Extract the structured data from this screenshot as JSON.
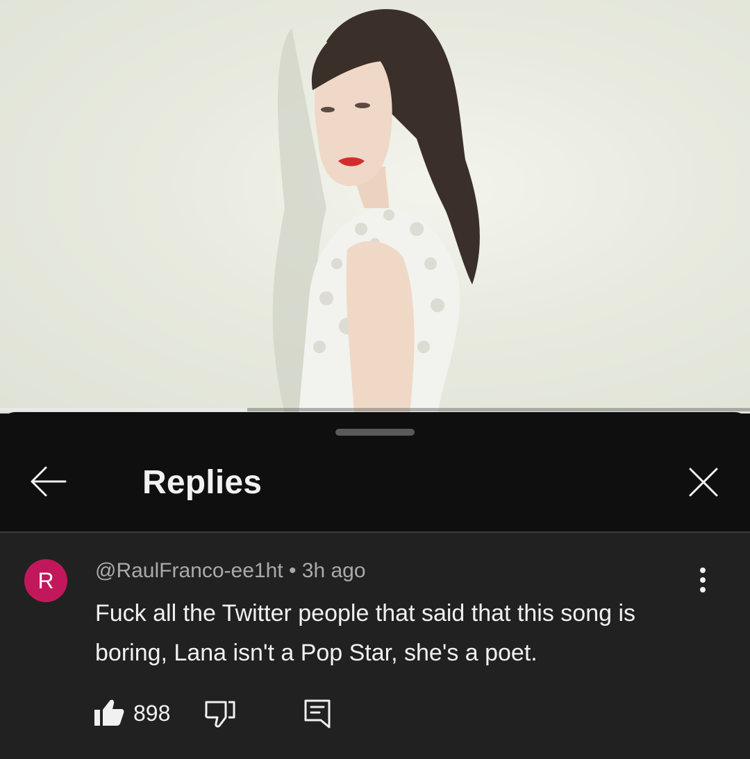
{
  "video": {
    "progress_fraction": 0.33,
    "thumbnail_subject": "woman in white lace dress with vintage waved hair"
  },
  "replies_panel": {
    "title": "Replies",
    "back_icon": "arrow-left-icon",
    "close_icon": "close-icon"
  },
  "comment": {
    "avatar_letter": "R",
    "avatar_color": "#c2185b",
    "author": "@RaulFranco-ee1ht",
    "separator": "•",
    "time": "3h ago",
    "text": "Fuck all the Twitter people that said that this song is boring, Lana isn't a Pop Star, she's a poet.",
    "like_count": "898",
    "icons": [
      "like-icon",
      "dislike-icon",
      "reply-icon",
      "more-vertical-icon"
    ]
  },
  "colors": {
    "sheet_bg": "#0f0f0f",
    "comment_bg": "#212121",
    "primary_text": "#f1f1f1",
    "secondary_text": "#aaaaaa"
  }
}
